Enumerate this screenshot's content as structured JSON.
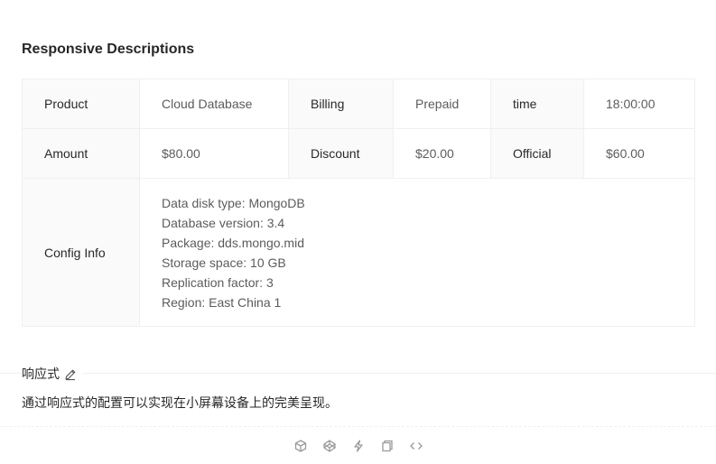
{
  "title": "Responsive Descriptions",
  "rows": [
    [
      {
        "label": "Product",
        "value": "Cloud Database"
      },
      {
        "label": "Billing",
        "value": "Prepaid"
      },
      {
        "label": "time",
        "value": "18:00:00"
      }
    ],
    [
      {
        "label": "Amount",
        "value": "$80.00"
      },
      {
        "label": "Discount",
        "value": "$20.00"
      },
      {
        "label": "Official",
        "value": "$60.00"
      }
    ]
  ],
  "config": {
    "label": "Config Info",
    "lines": [
      "Data disk type: MongoDB",
      "Database version: 3.4",
      "Package: dds.mongo.mid",
      "Storage space: 10 GB",
      "Replication factor: 3",
      "Region: East China 1"
    ]
  },
  "meta": {
    "title": "响应式",
    "description": "通过响应式的配置可以实现在小屏幕设备上的完美呈现。"
  },
  "actions": {
    "icons": [
      "codesandbox-icon",
      "codepen-icon",
      "stackblitz-icon",
      "copy-icon",
      "expand-code-icon"
    ]
  },
  "colors": {
    "label_bg": "#fafafa",
    "border": "#f0f0f0",
    "icon": "#9a9a9a"
  }
}
